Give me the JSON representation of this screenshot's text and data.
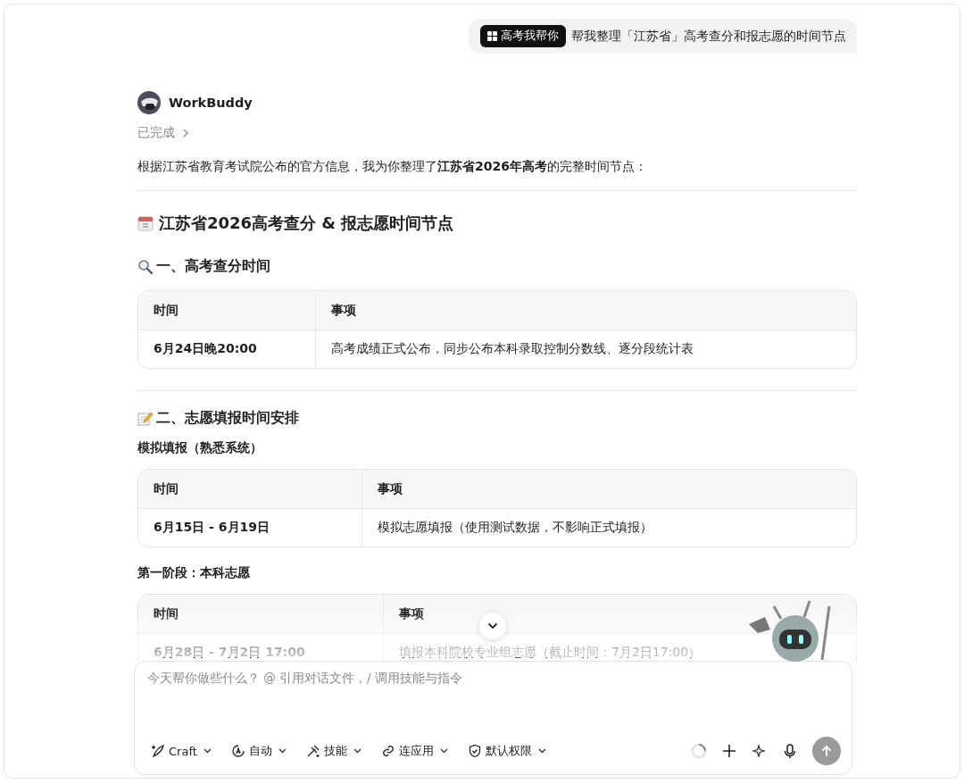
{
  "user_message": {
    "tag": "高考我帮你",
    "text": "帮我整理「江苏省」高考查分和报志愿的时间节点"
  },
  "assistant": {
    "name": "WorkBuddy",
    "status": "已完成",
    "intro": "根据江苏省教育考试院公布的官方信息，我为你整理了**江苏省2026年高考**的完整时间节点：",
    "title": {
      "text": "江苏省2026高考查分 & 报志愿时间节点"
    },
    "sections": [
      {
        "heading": "一、高考查分时间",
        "blocks": [
          {
            "columns": [
              "时间",
              "事项"
            ],
            "rows": [
              [
                "6月24日晚20:00",
                "高考成绩正式公布，同步公布本科录取控制分数线、逐分段统计表"
              ]
            ]
          }
        ]
      },
      {
        "heading": "二、志愿填报时间安排",
        "blocks": [
          {
            "subheading": "模拟填报（熟悉系统）",
            "columns": [
              "时间",
              "事项"
            ],
            "rows": [
              [
                "6月15日 - 6月19日",
                "模拟志愿填报（使用测试数据，不影响正式填报）"
              ]
            ]
          },
          {
            "subheading": "第一阶段：本科志愿",
            "columns": [
              "时间",
              "事项"
            ],
            "rows": [
              [
                "6月28日 - 7月2日 17:00",
                "填报本科院校专业组志愿（截止时间：7月2日17:00）"
              ]
            ]
          }
        ]
      }
    ]
  },
  "composer": {
    "placeholder": "今天帮你做些什么？ @ 引用对话文件，/ 调用技能与指令",
    "tools": [
      {
        "label": "Craft"
      },
      {
        "label": "自动"
      },
      {
        "label": "技能"
      },
      {
        "label": "连应用"
      },
      {
        "label": "默认权限"
      }
    ]
  }
}
